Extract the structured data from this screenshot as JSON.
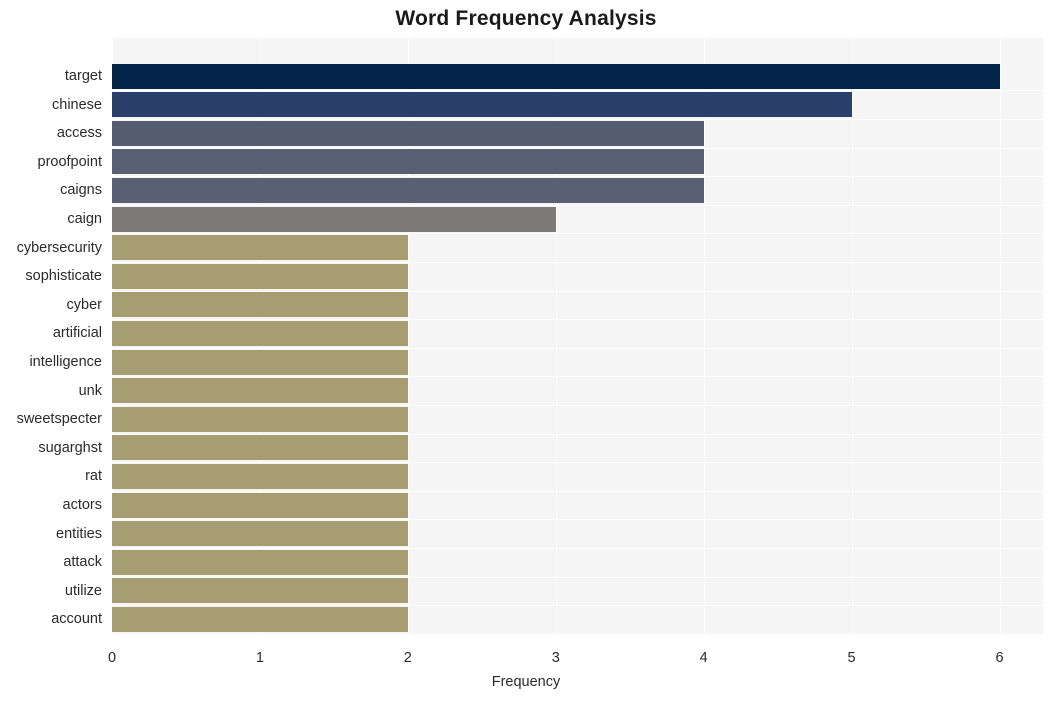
{
  "chart_data": {
    "type": "bar",
    "orientation": "horizontal",
    "title": "Word Frequency Analysis",
    "xlabel": "Frequency",
    "ylabel": "",
    "xlim": [
      0,
      6
    ],
    "xticks": [
      "0",
      "1",
      "2",
      "3",
      "4",
      "5",
      "6"
    ],
    "grid": true,
    "legend": "none",
    "categories": [
      "target",
      "chinese",
      "access",
      "proofpoint",
      "caigns",
      "caign",
      "cybersecurity",
      "sophisticate",
      "cyber",
      "artificial",
      "intelligence",
      "unk",
      "sweetspecter",
      "sugarghst",
      "rat",
      "actors",
      "entities",
      "attack",
      "utilize",
      "account"
    ],
    "values": [
      6,
      5,
      4,
      4,
      4,
      3,
      2,
      2,
      2,
      2,
      2,
      2,
      2,
      2,
      2,
      2,
      2,
      2,
      2,
      2
    ],
    "bar_colors": [
      "#032349",
      "#2b3f6b",
      "#565c70",
      "#5a6074",
      "#5a6074",
      "#7b7a78",
      "#a69d73",
      "#a69d73",
      "#a69d73",
      "#a69d73",
      "#a69d73",
      "#a69d73",
      "#a69d73",
      "#a69d73",
      "#a69d73",
      "#a69d73",
      "#a69d73",
      "#a69d73",
      "#a69d73",
      "#a69d73"
    ],
    "plot_background": "#f5f5f6",
    "grid_color": "#ffffff",
    "text_color": "#2b2b2b"
  }
}
